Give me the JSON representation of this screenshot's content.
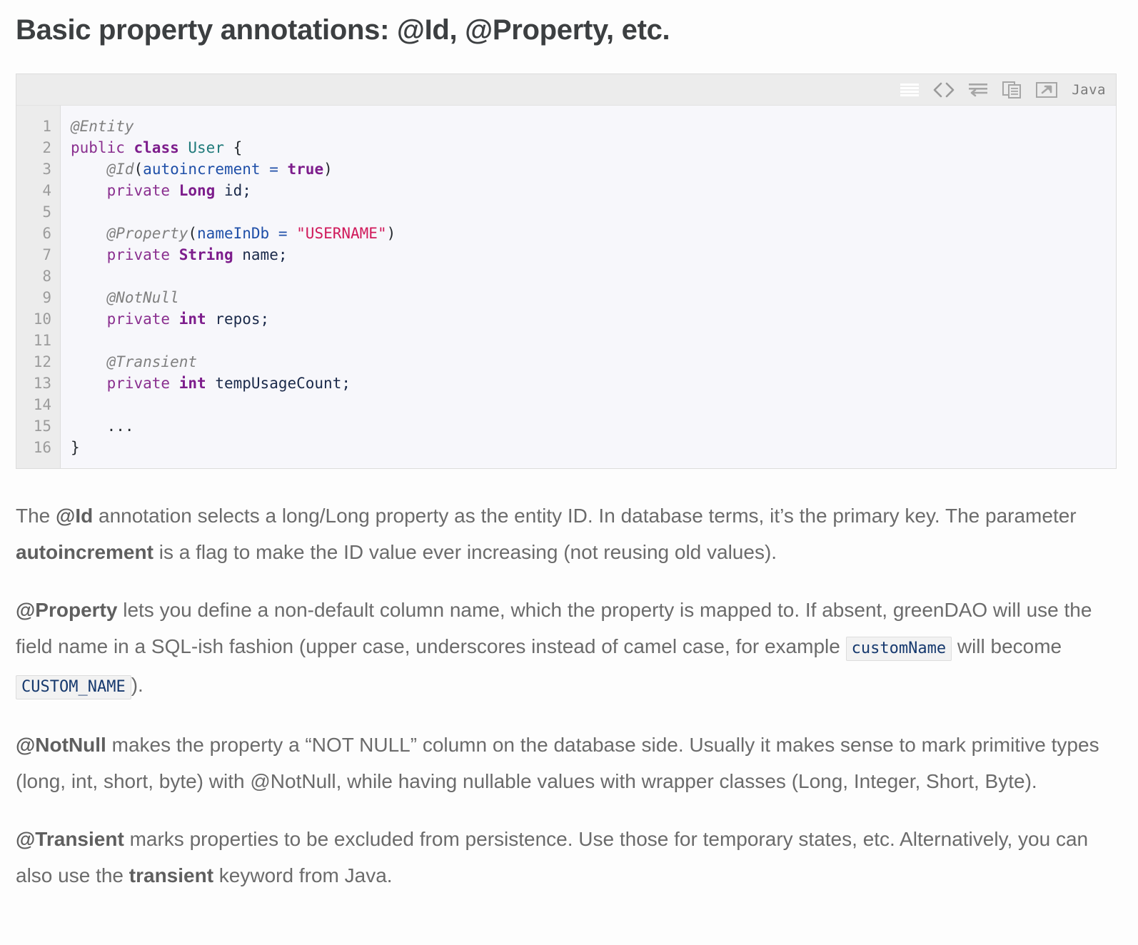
{
  "page": {
    "title": "Basic property annotations: @Id, @Property, etc."
  },
  "code_block": {
    "language_label": "Java",
    "toolbar_icons": [
      {
        "name": "show-lines-icon",
        "title": "Toggle line numbers"
      },
      {
        "name": "code-brackets-icon",
        "title": "View source"
      },
      {
        "name": "word-wrap-icon",
        "title": "Toggle word wrap"
      },
      {
        "name": "copy-icon",
        "title": "Copy to clipboard"
      },
      {
        "name": "open-in-new-window-icon",
        "title": "Open in new window"
      }
    ],
    "line_numbers": [
      "1",
      "2",
      "3",
      "4",
      "5",
      "6",
      "7",
      "8",
      "9",
      "10",
      "11",
      "12",
      "13",
      "14",
      "15",
      "16"
    ],
    "lines": [
      {
        "n": 1,
        "text": "@Entity"
      },
      {
        "n": 2,
        "text": "public class User {"
      },
      {
        "n": 3,
        "text": "    @Id(autoincrement = true)"
      },
      {
        "n": 4,
        "text": "    private Long id;"
      },
      {
        "n": 5,
        "text": ""
      },
      {
        "n": 6,
        "text": "    @Property(nameInDb = \"USERNAME\")"
      },
      {
        "n": 7,
        "text": "    private String name;"
      },
      {
        "n": 8,
        "text": ""
      },
      {
        "n": 9,
        "text": "    @NotNull"
      },
      {
        "n": 10,
        "text": "    private int repos;"
      },
      {
        "n": 11,
        "text": ""
      },
      {
        "n": 12,
        "text": "    @Transient"
      },
      {
        "n": 13,
        "text": "    private int tempUsageCount;"
      },
      {
        "n": 14,
        "text": ""
      },
      {
        "n": 15,
        "text": "    ..."
      },
      {
        "n": 16,
        "text": "}"
      }
    ]
  },
  "prose": {
    "p1": {
      "a": "The ",
      "b_bold": "@Id",
      "c": " annotation selects a long/Long property as the entity ID. In database terms, it’s the primary key. The parameter ",
      "d_bold": "autoincrement",
      "e": " is a flag to make the ID value ever increasing (not reusing old values)."
    },
    "p2": {
      "a_bold": "@Property",
      "b": " lets you define a non-default column name, which the property is mapped to. If absent, greenDAO will use the field name in a SQL-ish fashion (upper case, underscores instead of camel case, for example ",
      "chip1": "customName",
      "c": " will become ",
      "chip2": "CUSTOM_NAME",
      "d": ")."
    },
    "p3": {
      "a_bold": "@NotNull",
      "b": " makes the property a “NOT NULL” column on the database side. Usually it makes sense to mark primitive types (long, int, short, byte) with @NotNull, while having nullable values with wrapper classes (Long, Integer, Short, Byte)."
    },
    "p4": {
      "a_bold": "@Transient",
      "b": " marks properties to be excluded from persistence. Use those for temporary states, etc. Alternatively, you can also use the ",
      "c_bold": "transient",
      "d": " keyword from Java."
    }
  },
  "colors": {
    "page_background": "#fdfdfd",
    "heading_text": "#3c3f41",
    "body_text": "#6b6b6b",
    "code_background": "#f7f7fb",
    "gutter_background": "#ececec",
    "toolbar_background": "#ececec",
    "border": "#dcdcdc",
    "annotation": "#808080",
    "keyword": "#8a2f8f",
    "type": "#1f7a7a",
    "string": "#d01a5b",
    "parameter": "#1f4fa8",
    "identifier": "#1b2a4a",
    "chip_text": "#16396e"
  }
}
